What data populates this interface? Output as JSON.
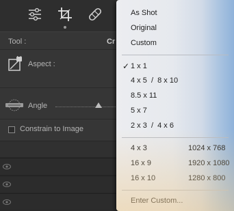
{
  "toolbar": {
    "icons": [
      "sliders-icon",
      "crop-icon",
      "healing-bandage-icon"
    ],
    "active": "crop-icon"
  },
  "panel": {
    "tool_label": "Tool :",
    "tool_value": "Cr",
    "aspect_label": "Aspect :",
    "angle_label": "Angle",
    "angle_slider_value": 0.65,
    "constrain_label": "Constrain to Image",
    "constrain_checked": false
  },
  "menu": {
    "group1": [
      "As Shot",
      "Original",
      "Custom"
    ],
    "ratios": [
      {
        "label": "1 x 1",
        "checked": true
      },
      {
        "label": "4 x 5  /  8 x 10",
        "checked": false
      },
      {
        "label": "8.5 x 11",
        "checked": false
      },
      {
        "label": "5 x 7",
        "checked": false
      },
      {
        "label": "2 x 3  /  4 x 6",
        "checked": false
      }
    ],
    "ratios_with_dims": [
      {
        "label": "4 x 3",
        "dims": "1024 x 768"
      },
      {
        "label": "16 x 9",
        "dims": "1920 x 1080"
      },
      {
        "label": "16 x 10",
        "dims": "1280 x 800"
      }
    ],
    "enter_custom": "Enter Custom...",
    "check_glyph": "✓"
  }
}
